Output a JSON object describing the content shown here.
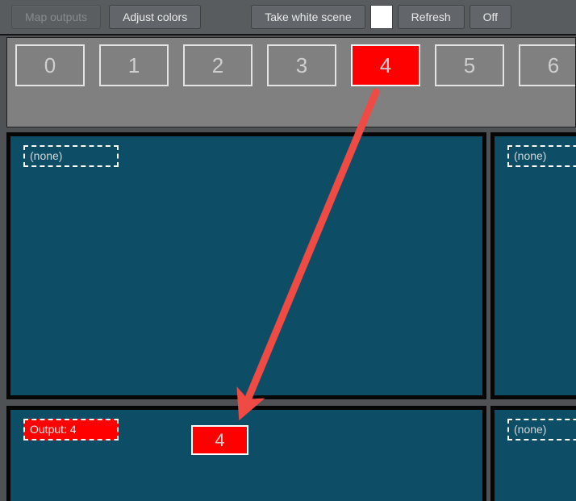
{
  "toolbar": {
    "map_outputs_label": "Map outputs",
    "map_outputs_disabled": true,
    "adjust_colors_label": "Adjust colors",
    "take_white_scene_label": "Take white scene",
    "color_swatch_value": "#ffffff",
    "refresh_label": "Refresh",
    "off_label": "Off"
  },
  "tabstrip": {
    "tabs": [
      {
        "label": "0",
        "selected": false
      },
      {
        "label": "1",
        "selected": false
      },
      {
        "label": "2",
        "selected": false
      },
      {
        "label": "3",
        "selected": false
      },
      {
        "label": "4",
        "selected": true
      },
      {
        "label": "5",
        "selected": false
      },
      {
        "label": "6",
        "selected": false
      }
    ],
    "selected_index": 4,
    "selected_color": "#ff0000"
  },
  "panels": {
    "top_left": {
      "label": "(none)",
      "active": false
    },
    "top_right": {
      "label": "(none)",
      "active": false
    },
    "bottom_left": {
      "label": "Output: 4",
      "active": true,
      "chip_value": "4"
    },
    "bottom_right": {
      "label": "(none)",
      "active": false
    }
  },
  "annotation": {
    "arrow_color": "#ef4a44",
    "from_label": "4",
    "to_label": "Output: 4"
  },
  "colors": {
    "background": "#4e5255",
    "toolbar": "#585c5e",
    "tabstrip": "#808080",
    "panel_fill": "#0d4e66",
    "panel_border": "#060606",
    "accent_red": "#ff0000"
  }
}
